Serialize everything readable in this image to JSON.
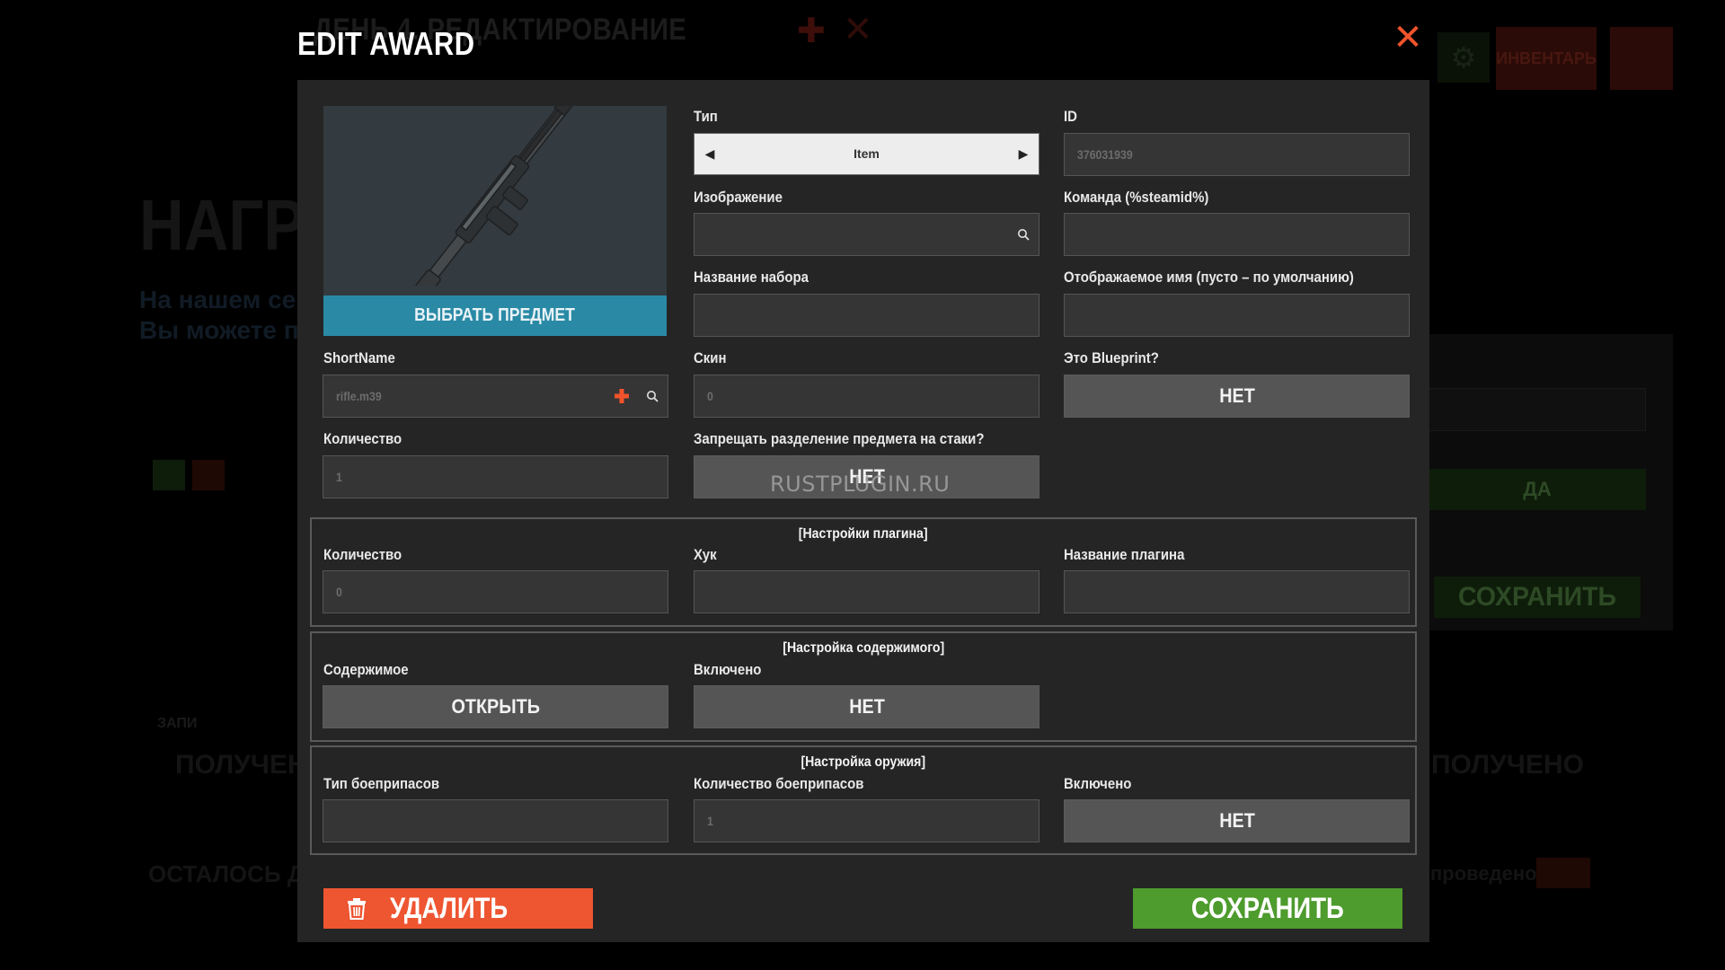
{
  "background": {
    "day_title": "ДЕНЬ 4. РЕДАКТИРОВАНИЕ",
    "heading_partial": "НАГР",
    "line1": "На нашем сер",
    "line2": "Вы можете по",
    "inventory_label": "ИНВЕНТАРЬ",
    "yes_label": "ДА",
    "save_label": "СОХРАНИТЬ",
    "received_left": "ПОЛУЧЕНО",
    "received_right": "ПОЛУЧЕНО",
    "remaining_left": "ОСТАЛОСЬ Д",
    "remaining_right": "проведено:",
    "small_label": "ЗАПИ"
  },
  "modal": {
    "title": "EDIT AWARD",
    "close_glyph": "✕",
    "choose_item_label": "ВЫБРАТЬ ПРЕДМЕТ",
    "fields": {
      "type": {
        "label": "Тип",
        "value": "Item"
      },
      "id": {
        "label": "ID",
        "value": "376031939"
      },
      "image": {
        "label": "Изображение",
        "value": ""
      },
      "command": {
        "label": "Команда (%steamid%)",
        "value": ""
      },
      "kit_name": {
        "label": "Название набора",
        "value": ""
      },
      "display_name": {
        "label": "Отображаемое имя (пусто – по умолчанию)",
        "value": ""
      },
      "shortname": {
        "label": "ShortName",
        "value": "rifle.m39"
      },
      "skin": {
        "label": "Скин",
        "value": "0"
      },
      "is_blueprint": {
        "label": "Это Blueprint?",
        "value": "НЕТ"
      },
      "amount": {
        "label": "Количество",
        "value": "1"
      },
      "prevent_split": {
        "label": "Запрещать разделение предмета на стаки?",
        "value": "НЕТ"
      }
    },
    "plugin_section": {
      "title": "[Настройки плагина]",
      "amount": {
        "label": "Количество",
        "value": "0"
      },
      "hook": {
        "label": "Хук",
        "value": ""
      },
      "plugin_name": {
        "label": "Название плагина",
        "value": ""
      }
    },
    "contents_section": {
      "title": "[Настройка содержимого]",
      "contents": {
        "label": "Содержимое",
        "value": "ОТКРЫТЬ"
      },
      "enabled": {
        "label": "Включено",
        "value": "НЕТ"
      }
    },
    "weapon_section": {
      "title": "[Настройка оружия]",
      "ammo_type": {
        "label": "Тип боеприпасов",
        "value": ""
      },
      "ammo_amount": {
        "label": "Количество боеприпасов",
        "value": "1"
      },
      "enabled": {
        "label": "Включено",
        "value": "НЕТ"
      }
    },
    "delete_label": "УДАЛИТЬ",
    "save_label": "СОХРАНИТЬ",
    "watermark": "RUSTPLUGIN.RU"
  },
  "colors": {
    "accent_blue": "#2a8aa6",
    "delete_red": "#ee5531",
    "save_green": "#4e9b2e",
    "close_red": "#f0532b"
  }
}
